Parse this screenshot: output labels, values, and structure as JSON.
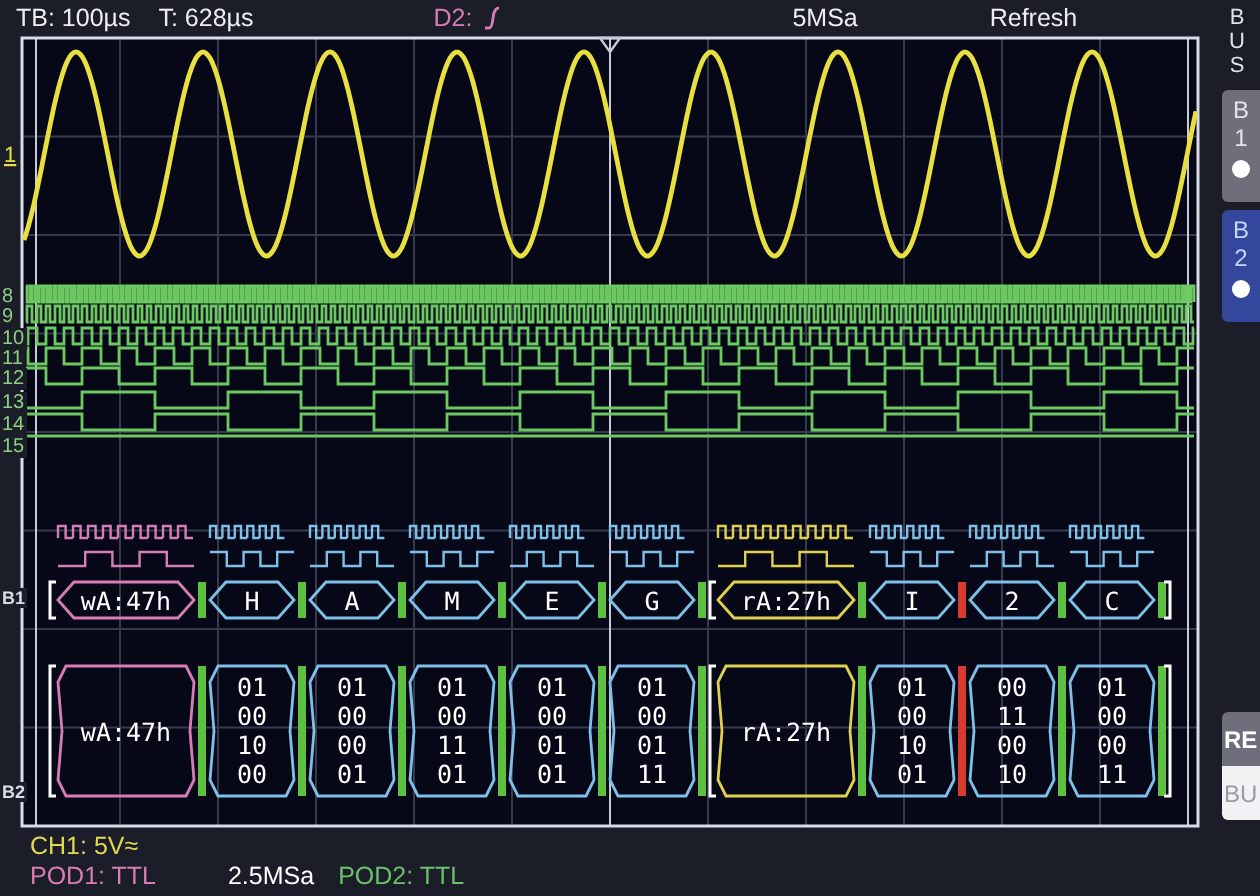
{
  "status_bar": {
    "timebase": "TB: 100µs",
    "trigger_time": "T: 628µs",
    "trigger_source": "D2:",
    "sample_rate": "5MSa",
    "mode": "Refresh"
  },
  "analog_channels": [
    {
      "label": "1"
    }
  ],
  "digital_channels": [
    {
      "label": "8"
    },
    {
      "label": "9"
    },
    {
      "label": "10"
    },
    {
      "label": "11"
    },
    {
      "label": "12"
    },
    {
      "label": "13"
    },
    {
      "label": "14"
    },
    {
      "label": "15"
    }
  ],
  "buses": [
    {
      "label": "B1",
      "frames": [
        {
          "kind": "address",
          "text": "wA:47h",
          "color": "#d77cb4",
          "ack": true
        },
        {
          "kind": "data",
          "text": "H",
          "color": "#7ec0e8",
          "ack": true
        },
        {
          "kind": "data",
          "text": "A",
          "color": "#7ec0e8",
          "ack": true
        },
        {
          "kind": "data",
          "text": "M",
          "color": "#7ec0e8",
          "ack": true
        },
        {
          "kind": "data",
          "text": "E",
          "color": "#7ec0e8",
          "ack": true
        },
        {
          "kind": "data",
          "text": "G",
          "color": "#7ec0e8",
          "ack": true
        },
        {
          "kind": "address",
          "text": "rA:27h",
          "color": "#e0d050",
          "ack": true
        },
        {
          "kind": "data",
          "text": "I",
          "color": "#7ec0e8",
          "ack": false
        },
        {
          "kind": "data",
          "text": "2",
          "color": "#7ec0e8",
          "ack": true
        },
        {
          "kind": "data",
          "text": "C",
          "color": "#7ec0e8",
          "ack": true
        }
      ]
    },
    {
      "label": "B2",
      "frames": [
        {
          "kind": "address",
          "text": "wA:47h",
          "color": "#d77cb4",
          "ack": true
        },
        {
          "kind": "data",
          "lines": [
            "01",
            "00",
            "10",
            "00"
          ],
          "color": "#7ec0e8",
          "ack": true
        },
        {
          "kind": "data",
          "lines": [
            "01",
            "00",
            "00",
            "01"
          ],
          "color": "#7ec0e8",
          "ack": true
        },
        {
          "kind": "data",
          "lines": [
            "01",
            "00",
            "11",
            "01"
          ],
          "color": "#7ec0e8",
          "ack": true
        },
        {
          "kind": "data",
          "lines": [
            "01",
            "00",
            "01",
            "01"
          ],
          "color": "#7ec0e8",
          "ack": true
        },
        {
          "kind": "data",
          "lines": [
            "01",
            "00",
            "01",
            "11"
          ],
          "color": "#7ec0e8",
          "ack": true
        },
        {
          "kind": "address",
          "text": "rA:27h",
          "color": "#e0d050",
          "ack": true
        },
        {
          "kind": "data",
          "lines": [
            "01",
            "00",
            "10",
            "01"
          ],
          "color": "#7ec0e8",
          "ack": false
        },
        {
          "kind": "data",
          "lines": [
            "00",
            "11",
            "00",
            "10"
          ],
          "color": "#7ec0e8",
          "ack": true
        },
        {
          "kind": "data",
          "lines": [
            "01",
            "00",
            "00",
            "11"
          ],
          "color": "#7ec0e8",
          "ack": true
        }
      ]
    }
  ],
  "sidebar": {
    "title": "BUS",
    "buttons": [
      {
        "label": "B1",
        "selected": false
      },
      {
        "label": "B2",
        "selected": true
      }
    ],
    "cut_buttons": [
      {
        "label": "RE"
      },
      {
        "label": "BU"
      }
    ]
  },
  "footer": {
    "channel": "CH1: 5V≈",
    "items": [
      {
        "text": "POD1: TTL",
        "color": "#d77cb4"
      },
      {
        "text": "2.5MSa",
        "color": "#ffffff"
      },
      {
        "text": "POD2: TTL",
        "color": "#6cc06c"
      }
    ]
  }
}
